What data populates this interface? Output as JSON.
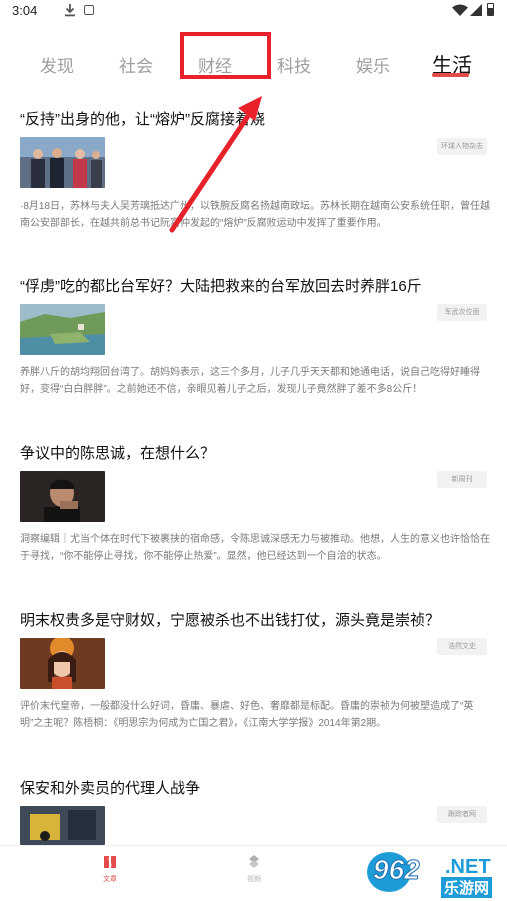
{
  "status_bar": {
    "time": "3:04",
    "icons": [
      "download-icon",
      "app-icon",
      "wifi-icon",
      "signal-icon",
      "battery-icon"
    ]
  },
  "tabs": [
    {
      "label": "发现",
      "active": false
    },
    {
      "label": "社会",
      "active": false
    },
    {
      "label": "财经",
      "active": false
    },
    {
      "label": "科技",
      "active": false
    },
    {
      "label": "娱乐",
      "active": false
    },
    {
      "label": "生活",
      "active": true
    }
  ],
  "annotation": {
    "highlight_color": "#e8212a",
    "highlighted_tab": "财经"
  },
  "articles": [
    {
      "title": "“反持”出身的他，让“熔炉”反腐接着烧",
      "source": "环球人物杂志",
      "summary": "·8月18日，苏林与夫人吴芳璃抵达广州，以铁腕反腐名扬越南政坛。苏林长期在越南公安系统任职，曾任越南公安部部长，在越共前总书记阮富仲发起的“熔炉”反腐败运动中发挥了重要作用。"
    },
    {
      "title": "“俘虏”吃的都比台军好？大陆把救来的台军放回去时养胖16斤",
      "source": "军武次位面",
      "summary": "养胖八斤的胡均翔回台湾了。胡妈妈表示，这三个多月，儿子几乎天天都和她通电话，说自己吃得好睡得好，变得“白白胖胖”。之前她还不信，亲眼见着儿子之后，发现儿子竟然胖了差不多8公斤！"
    },
    {
      "title": "争议中的陈思诚，在想什么？",
      "source": "新周刊",
      "summary": "洞察编辑｜尤当个体在时代下被裹挟的宿命感，令陈思诚深感无力与被推动。他想，人生的意义也许恰恰在于寻找，“你不能停止寻找，你不能停止热爱”。显然，他已经达到一个自洽的状态。"
    },
    {
      "title": "明末权贵多是守财奴，宁愿被杀也不出钱打仗，源头竟是崇祯？",
      "source": "浩然文史",
      "summary": "评价末代皇帝，一般都没什么好词，昏庸、暴虐、好色、奢靡都是标配。昏庸的崇祯为何被塑造成了“英明”之主呢？陈梧桐：《明思宗为何成为亡国之君》，《江南大学学报》2014年第2期。"
    },
    {
      "title": "保安和外卖员的代理人战争",
      "source": "跟踪者网",
      "summary": ""
    }
  ],
  "bottom_nav": [
    {
      "label": "文章",
      "active": true,
      "icon": "article-icon"
    },
    {
      "label": "视频",
      "active": false,
      "icon": "video-icon"
    }
  ],
  "watermark": {
    "main": "962",
    "suffix": ".NET",
    "cn": "乐游网"
  },
  "colors": {
    "accent": "#e34a4a",
    "watermark_blue": "#1d9cd8"
  }
}
